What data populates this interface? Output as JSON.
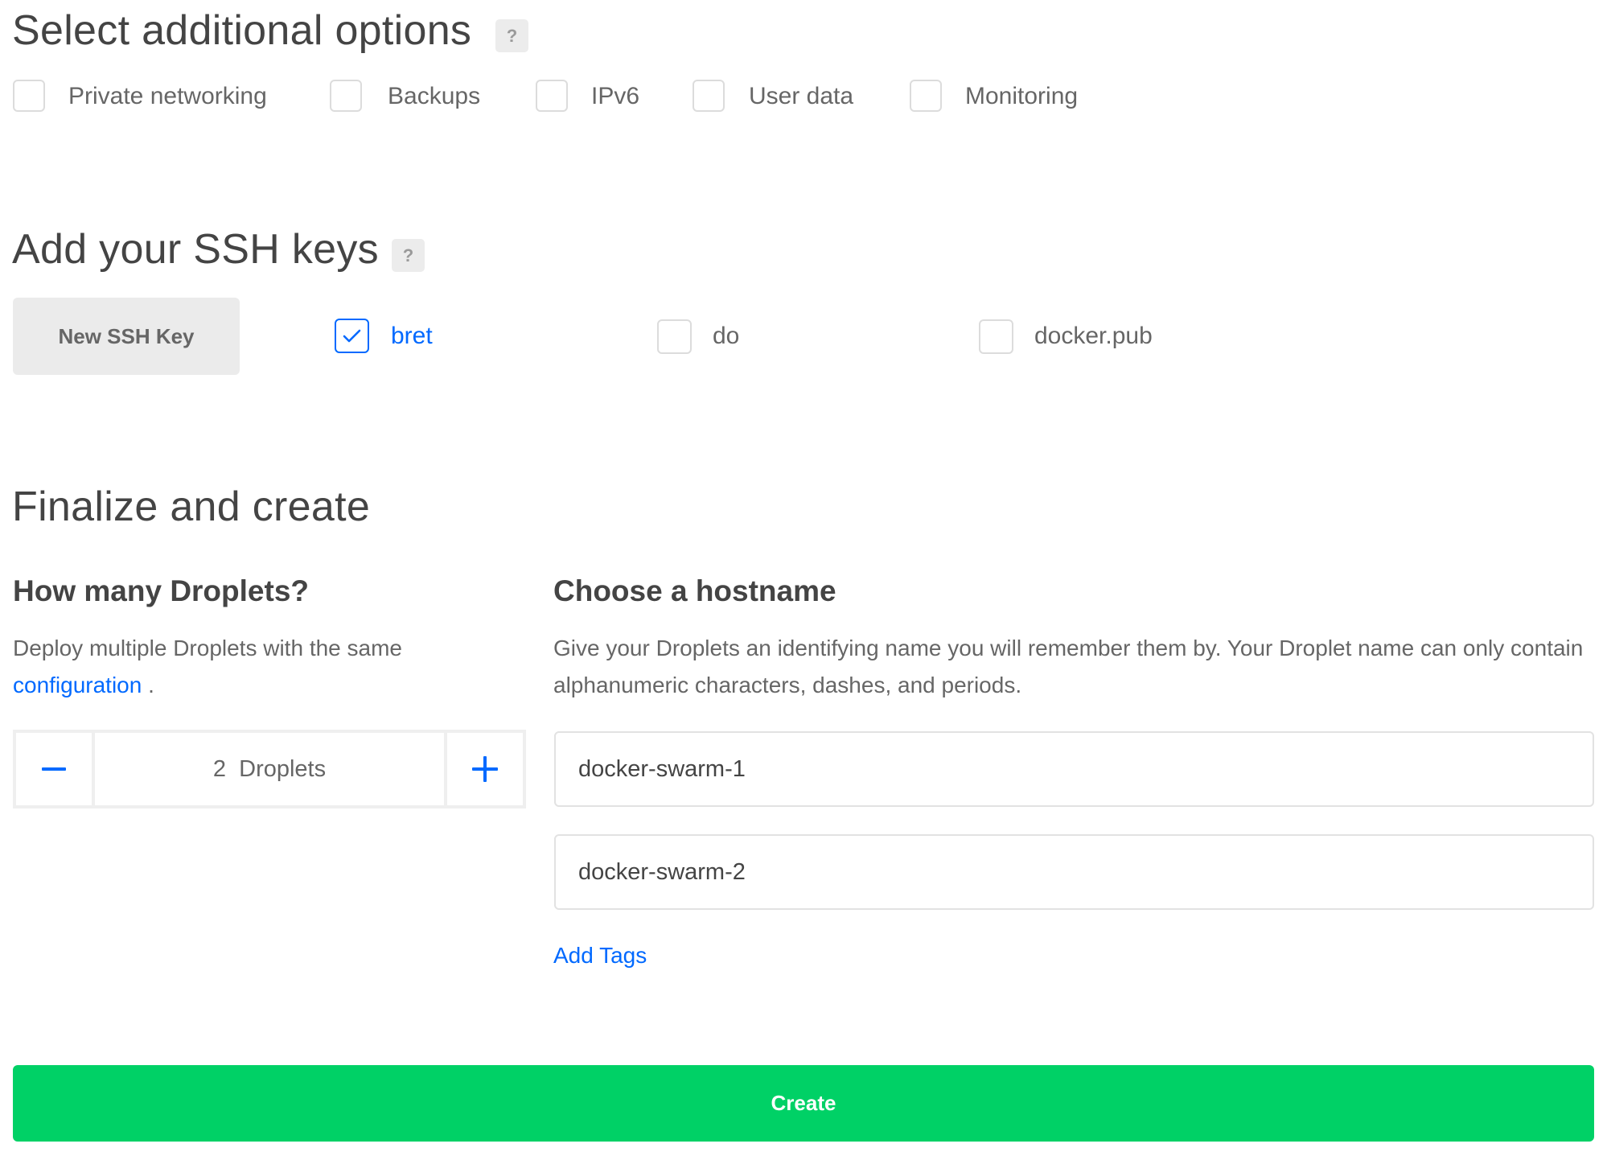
{
  "options": {
    "title": "Select additional options",
    "help_label": "?",
    "items": [
      {
        "label": "Private networking",
        "checked": false
      },
      {
        "label": "Backups",
        "checked": false
      },
      {
        "label": "IPv6",
        "checked": false
      },
      {
        "label": "User data",
        "checked": false
      },
      {
        "label": "Monitoring",
        "checked": false
      }
    ]
  },
  "ssh": {
    "title": "Add your SSH keys",
    "help_label": "?",
    "new_key_label": "New SSH Key",
    "keys": [
      {
        "label": "bret",
        "checked": true
      },
      {
        "label": "do",
        "checked": false
      },
      {
        "label": "docker.pub",
        "checked": false
      }
    ]
  },
  "finalize": {
    "title": "Finalize and create",
    "droplets": {
      "heading": "How many Droplets?",
      "description": "Deploy multiple Droplets with the same",
      "link_text": "configuration",
      "link_suffix": " .",
      "count": "2",
      "unit": "Droplets",
      "decrement_icon": "minus-icon",
      "increment_icon": "plus-icon"
    },
    "hostname": {
      "heading": "Choose a hostname",
      "description": "Give your Droplets an identifying name you will remember them by. Your Droplet name can only contain alphanumeric characters, dashes, and periods.",
      "values": [
        "docker-swarm-1",
        "docker-swarm-2"
      ],
      "add_tags_label": "Add Tags"
    },
    "create_label": "Create"
  },
  "colors": {
    "accent": "#0069ff",
    "create": "#00d166",
    "text": "#444444",
    "muted": "#666666"
  }
}
